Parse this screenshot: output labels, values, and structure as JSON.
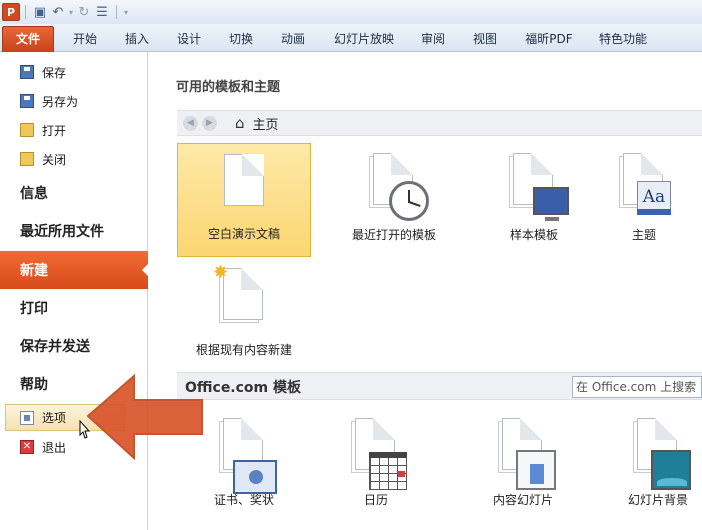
{
  "qat": {
    "app_icon_letter": "P",
    "icons": [
      "save-icon",
      "undo-icon",
      "redo-icon",
      "customize-icon"
    ]
  },
  "ribbon": {
    "tabs": [
      "文件",
      "开始",
      "插入",
      "设计",
      "切换",
      "动画",
      "幻灯片放映",
      "审阅",
      "视图",
      "福昕PDF",
      "特色功能"
    ]
  },
  "nav": {
    "save": "保存",
    "save_as": "另存为",
    "open": "打开",
    "close": "关闭",
    "info": "信息",
    "recent": "最近所用文件",
    "new": "新建",
    "print": "打印",
    "save_send": "保存并发送",
    "help": "帮助",
    "options": "选项",
    "exit": "退出"
  },
  "main": {
    "section_title": "可用的模板和主题",
    "breadcrumb": "主页",
    "templates": [
      {
        "label": "空白演示文稿",
        "icon": "blank-document-icon",
        "selected": true
      },
      {
        "label": "最近打开的模板",
        "icon": "recent-clock-icon"
      },
      {
        "label": "样本模板",
        "icon": "sample-monitor-icon"
      },
      {
        "label": "主题",
        "icon": "theme-aa-icon"
      },
      {
        "label": "根据现有内容新建",
        "icon": "new-from-existing-icon"
      }
    ],
    "office_section": {
      "title": "Office.com 模板",
      "search_placeholder": "在 Office.com 上搜索"
    },
    "office_templates": [
      {
        "label": "证书、奖状",
        "icon": "certificate-icon"
      },
      {
        "label": "日历",
        "icon": "calendar-icon"
      },
      {
        "label": "内容幻灯片",
        "icon": "content-slide-icon"
      },
      {
        "label": "幻灯片背景",
        "icon": "slide-background-icon"
      }
    ]
  },
  "colors": {
    "accent": "#d84b1b",
    "selected_tile": "#fbd671",
    "arrow": "#d9542a"
  }
}
